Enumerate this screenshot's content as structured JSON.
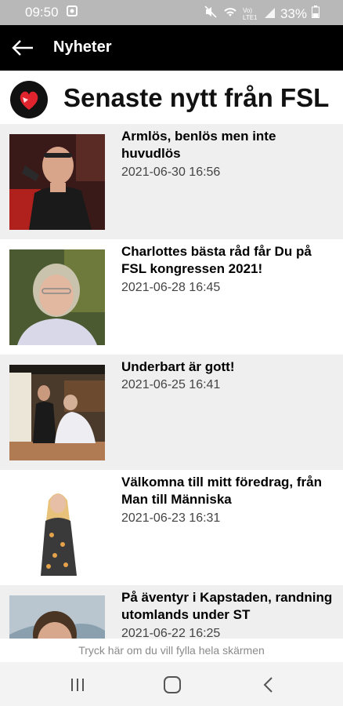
{
  "status_bar": {
    "time": "09:50",
    "battery": "33%",
    "network_label": "Vo) LTE1"
  },
  "app_bar": {
    "title": "Nyheter"
  },
  "header": {
    "title": "Senaste nytt från FSL"
  },
  "news": [
    {
      "title": "Armlös, benlös men inte huvudlös",
      "date": "2021-06-30 16:56"
    },
    {
      "title": "Charlottes bästa råd får Du på FSL kongressen 2021!",
      "date": "2021-06-28 16:45"
    },
    {
      "title": "Underbart är gott!",
      "date": "2021-06-25 16:41"
    },
    {
      "title": "Välkomna till mitt föredrag, från Man till Människa",
      "date": "2021-06-23 16:31"
    },
    {
      "title": "På äventyr i Kapstaden, randning utomlands under ST",
      "date": "2021-06-22 16:25"
    }
  ],
  "footer": {
    "fullscreen_hint": "Tryck här om du vill fylla hela skärmen"
  },
  "colors": {
    "app_bar": "#000000",
    "status_bar": "#b8b8b8",
    "logo_red": "#e0242e",
    "item_gray": "#efefef"
  },
  "icons": [
    "back-arrow-icon",
    "fsl-logo-icon",
    "recents-icon",
    "home-icon",
    "back-nav-icon"
  ]
}
